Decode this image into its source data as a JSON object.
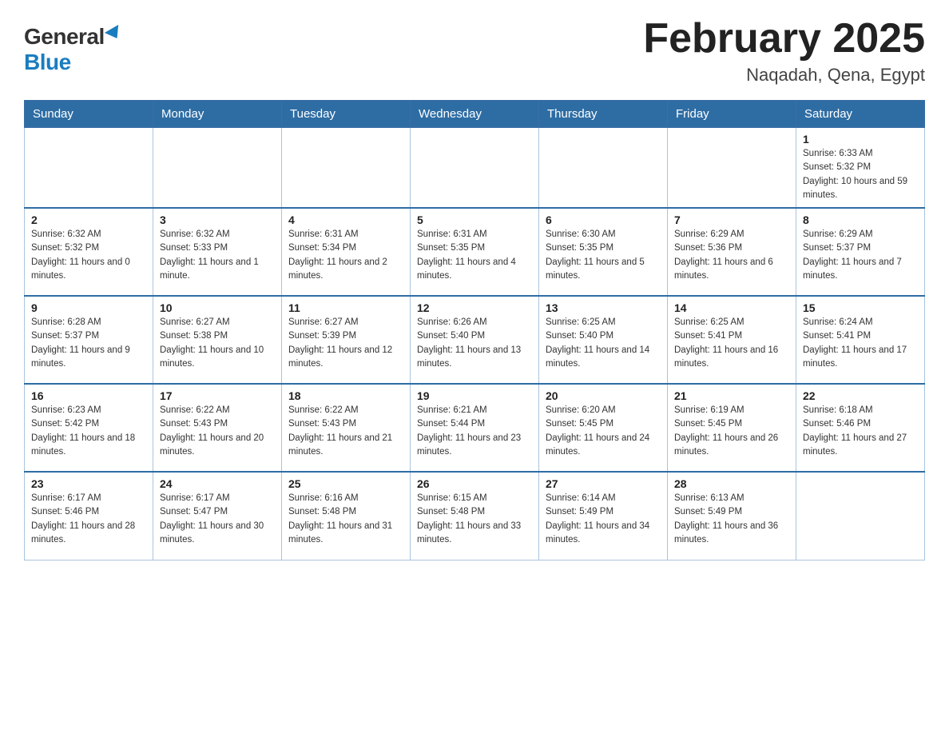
{
  "header": {
    "logo_general": "General",
    "logo_blue": "Blue",
    "title": "February 2025",
    "subtitle": "Naqadah, Qena, Egypt"
  },
  "calendar": {
    "weekdays": [
      "Sunday",
      "Monday",
      "Tuesday",
      "Wednesday",
      "Thursday",
      "Friday",
      "Saturday"
    ],
    "weeks": [
      [
        {
          "day": "",
          "sunrise": "",
          "sunset": "",
          "daylight": ""
        },
        {
          "day": "",
          "sunrise": "",
          "sunset": "",
          "daylight": ""
        },
        {
          "day": "",
          "sunrise": "",
          "sunset": "",
          "daylight": ""
        },
        {
          "day": "",
          "sunrise": "",
          "sunset": "",
          "daylight": ""
        },
        {
          "day": "",
          "sunrise": "",
          "sunset": "",
          "daylight": ""
        },
        {
          "day": "",
          "sunrise": "",
          "sunset": "",
          "daylight": ""
        },
        {
          "day": "1",
          "sunrise": "Sunrise: 6:33 AM",
          "sunset": "Sunset: 5:32 PM",
          "daylight": "Daylight: 10 hours and 59 minutes."
        }
      ],
      [
        {
          "day": "2",
          "sunrise": "Sunrise: 6:32 AM",
          "sunset": "Sunset: 5:32 PM",
          "daylight": "Daylight: 11 hours and 0 minutes."
        },
        {
          "day": "3",
          "sunrise": "Sunrise: 6:32 AM",
          "sunset": "Sunset: 5:33 PM",
          "daylight": "Daylight: 11 hours and 1 minute."
        },
        {
          "day": "4",
          "sunrise": "Sunrise: 6:31 AM",
          "sunset": "Sunset: 5:34 PM",
          "daylight": "Daylight: 11 hours and 2 minutes."
        },
        {
          "day": "5",
          "sunrise": "Sunrise: 6:31 AM",
          "sunset": "Sunset: 5:35 PM",
          "daylight": "Daylight: 11 hours and 4 minutes."
        },
        {
          "day": "6",
          "sunrise": "Sunrise: 6:30 AM",
          "sunset": "Sunset: 5:35 PM",
          "daylight": "Daylight: 11 hours and 5 minutes."
        },
        {
          "day": "7",
          "sunrise": "Sunrise: 6:29 AM",
          "sunset": "Sunset: 5:36 PM",
          "daylight": "Daylight: 11 hours and 6 minutes."
        },
        {
          "day": "8",
          "sunrise": "Sunrise: 6:29 AM",
          "sunset": "Sunset: 5:37 PM",
          "daylight": "Daylight: 11 hours and 7 minutes."
        }
      ],
      [
        {
          "day": "9",
          "sunrise": "Sunrise: 6:28 AM",
          "sunset": "Sunset: 5:37 PM",
          "daylight": "Daylight: 11 hours and 9 minutes."
        },
        {
          "day": "10",
          "sunrise": "Sunrise: 6:27 AM",
          "sunset": "Sunset: 5:38 PM",
          "daylight": "Daylight: 11 hours and 10 minutes."
        },
        {
          "day": "11",
          "sunrise": "Sunrise: 6:27 AM",
          "sunset": "Sunset: 5:39 PM",
          "daylight": "Daylight: 11 hours and 12 minutes."
        },
        {
          "day": "12",
          "sunrise": "Sunrise: 6:26 AM",
          "sunset": "Sunset: 5:40 PM",
          "daylight": "Daylight: 11 hours and 13 minutes."
        },
        {
          "day": "13",
          "sunrise": "Sunrise: 6:25 AM",
          "sunset": "Sunset: 5:40 PM",
          "daylight": "Daylight: 11 hours and 14 minutes."
        },
        {
          "day": "14",
          "sunrise": "Sunrise: 6:25 AM",
          "sunset": "Sunset: 5:41 PM",
          "daylight": "Daylight: 11 hours and 16 minutes."
        },
        {
          "day": "15",
          "sunrise": "Sunrise: 6:24 AM",
          "sunset": "Sunset: 5:41 PM",
          "daylight": "Daylight: 11 hours and 17 minutes."
        }
      ],
      [
        {
          "day": "16",
          "sunrise": "Sunrise: 6:23 AM",
          "sunset": "Sunset: 5:42 PM",
          "daylight": "Daylight: 11 hours and 18 minutes."
        },
        {
          "day": "17",
          "sunrise": "Sunrise: 6:22 AM",
          "sunset": "Sunset: 5:43 PM",
          "daylight": "Daylight: 11 hours and 20 minutes."
        },
        {
          "day": "18",
          "sunrise": "Sunrise: 6:22 AM",
          "sunset": "Sunset: 5:43 PM",
          "daylight": "Daylight: 11 hours and 21 minutes."
        },
        {
          "day": "19",
          "sunrise": "Sunrise: 6:21 AM",
          "sunset": "Sunset: 5:44 PM",
          "daylight": "Daylight: 11 hours and 23 minutes."
        },
        {
          "day": "20",
          "sunrise": "Sunrise: 6:20 AM",
          "sunset": "Sunset: 5:45 PM",
          "daylight": "Daylight: 11 hours and 24 minutes."
        },
        {
          "day": "21",
          "sunrise": "Sunrise: 6:19 AM",
          "sunset": "Sunset: 5:45 PM",
          "daylight": "Daylight: 11 hours and 26 minutes."
        },
        {
          "day": "22",
          "sunrise": "Sunrise: 6:18 AM",
          "sunset": "Sunset: 5:46 PM",
          "daylight": "Daylight: 11 hours and 27 minutes."
        }
      ],
      [
        {
          "day": "23",
          "sunrise": "Sunrise: 6:17 AM",
          "sunset": "Sunset: 5:46 PM",
          "daylight": "Daylight: 11 hours and 28 minutes."
        },
        {
          "day": "24",
          "sunrise": "Sunrise: 6:17 AM",
          "sunset": "Sunset: 5:47 PM",
          "daylight": "Daylight: 11 hours and 30 minutes."
        },
        {
          "day": "25",
          "sunrise": "Sunrise: 6:16 AM",
          "sunset": "Sunset: 5:48 PM",
          "daylight": "Daylight: 11 hours and 31 minutes."
        },
        {
          "day": "26",
          "sunrise": "Sunrise: 6:15 AM",
          "sunset": "Sunset: 5:48 PM",
          "daylight": "Daylight: 11 hours and 33 minutes."
        },
        {
          "day": "27",
          "sunrise": "Sunrise: 6:14 AM",
          "sunset": "Sunset: 5:49 PM",
          "daylight": "Daylight: 11 hours and 34 minutes."
        },
        {
          "day": "28",
          "sunrise": "Sunrise: 6:13 AM",
          "sunset": "Sunset: 5:49 PM",
          "daylight": "Daylight: 11 hours and 36 minutes."
        },
        {
          "day": "",
          "sunrise": "",
          "sunset": "",
          "daylight": ""
        }
      ]
    ]
  }
}
